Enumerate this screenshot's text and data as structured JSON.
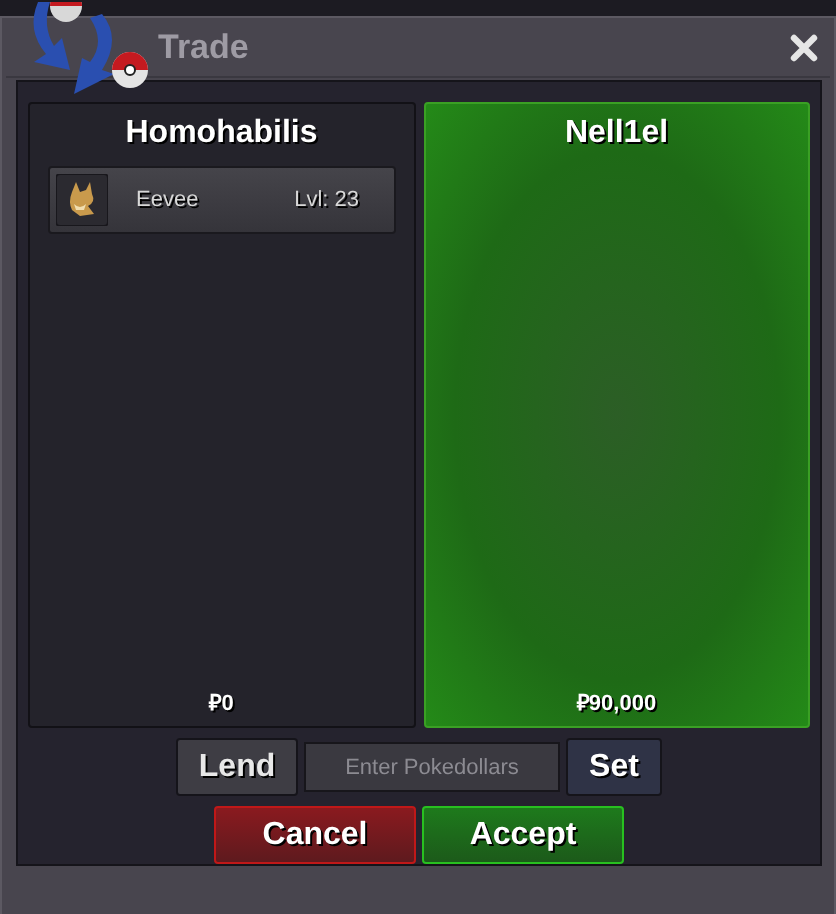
{
  "window": {
    "title": "Trade"
  },
  "panels": [
    {
      "trainer": "Homohabilis",
      "accepted": false,
      "items": [
        {
          "name": "Eevee",
          "level": "Lvl: 23"
        }
      ],
      "money": "₽0"
    },
    {
      "trainer": "Nell1el",
      "accepted": true,
      "money": "₽90,000"
    }
  ],
  "money_row": {
    "lend": "Lend",
    "field": {
      "placeholder": "Enter Pokedollars"
    },
    "set": "Set"
  },
  "actions": [
    {
      "label": "Cancel",
      "kind": "cancel"
    },
    {
      "label": "Accept",
      "kind": "accept"
    }
  ]
}
